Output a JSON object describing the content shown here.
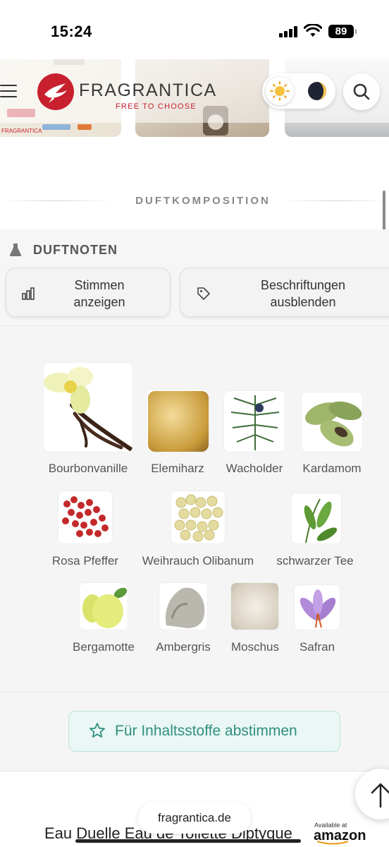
{
  "status_bar": {
    "time": "15:24",
    "battery": "89"
  },
  "header": {
    "logo_text": "FRAGRANTICA",
    "logo_tagline": "FREE TO CHOOSE",
    "strip_mini_label": "FRAGRANTICA"
  },
  "section": {
    "title": "DUFTKOMPOSITION"
  },
  "notes_header": {
    "title": "DUFTNOTEN",
    "votes_button": "Stimmen anzeigen",
    "labels_button": "Beschriftungen ausblenden"
  },
  "notes": [
    {
      "name": "Bourbonvanille",
      "icon": "vanilla-icon"
    },
    {
      "name": "Elemiharz",
      "icon": "elemi-resin-icon"
    },
    {
      "name": "Wacholder",
      "icon": "juniper-icon"
    },
    {
      "name": "Kardamom",
      "icon": "cardamom-icon"
    },
    {
      "name": "Rosa Pfeffer",
      "icon": "pink-pepper-icon"
    },
    {
      "name": "Weihrauch Olibanum",
      "icon": "frankincense-icon"
    },
    {
      "name": "schwarzer Tee",
      "icon": "black-tea-icon"
    },
    {
      "name": "Bergamotte",
      "icon": "bergamot-icon"
    },
    {
      "name": "Ambergris",
      "icon": "ambergris-icon"
    },
    {
      "name": "Moschus",
      "icon": "musk-icon"
    },
    {
      "name": "Safran",
      "icon": "saffron-icon"
    }
  ],
  "vote_button": {
    "label": "Für Inhaltsstoffe abstimmen"
  },
  "footer": {
    "url": "fragrantica.de",
    "product_title": "Eau Duelle Eau de Toilette Diptyque",
    "amazon_small": "Available at",
    "amazon_logo": "amazon"
  },
  "colors": {
    "brand_red": "#c8202f",
    "vote_green": "#2f8f7f"
  }
}
